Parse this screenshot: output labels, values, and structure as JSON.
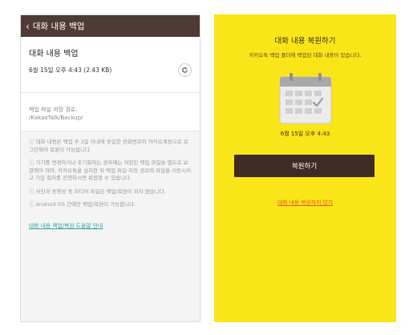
{
  "left": {
    "header_title": "대화 내용 백업",
    "card_title": "대화 내용 백업",
    "card_meta": "6월 15일 오후 4:43 (2.43 KB)",
    "path_label": "백업 파일 저장 경로:",
    "path_value": "/KakaoTalk/Backup/",
    "notes": [
      "ⓘ 대화 내용은 백업 후 3일 이내에 동일한 전화번호와 카카오계정으로 로그인해야 복원이 가능합니다.",
      "ⓘ 기기를 변경하거나 초기화하는 경우에는 저장된 백업 파일을 별도로 보관해야 하며, 카카오톡을 설치한 뒤 백업 파일 저장 경로에 파일을 이동시키고 가입 절차를 진행하시면 복원할 수 있습니다.",
      "ⓘ 사진과 동영상 등 미디어 파일은 백업/복원이 되지 않습니다.",
      "ⓘ Android OS 간에만 백업/복원이 가능합니다."
    ],
    "help_link": "대화 내용 백업/복원 도움말 안내"
  },
  "right": {
    "title": "대화 내용 복원하기",
    "subtitle": "카카오톡 백업 폴더에 백업된 대화 내용이 있습니다.",
    "date": "6월 15일 오후 4:43",
    "restore_button": "복원하기",
    "skip_link": "대화 내용 복원하지 않기"
  },
  "colors": {
    "header_bg": "#4e3b35",
    "yellow": "#fae518",
    "button_bg": "#3e2b24",
    "link_teal": "#2aa6a0",
    "link_orange": "#e05a1e"
  },
  "icons": {
    "back": "chevron-left-icon",
    "refresh": "refresh-icon",
    "calendar": "calendar-check-icon"
  }
}
